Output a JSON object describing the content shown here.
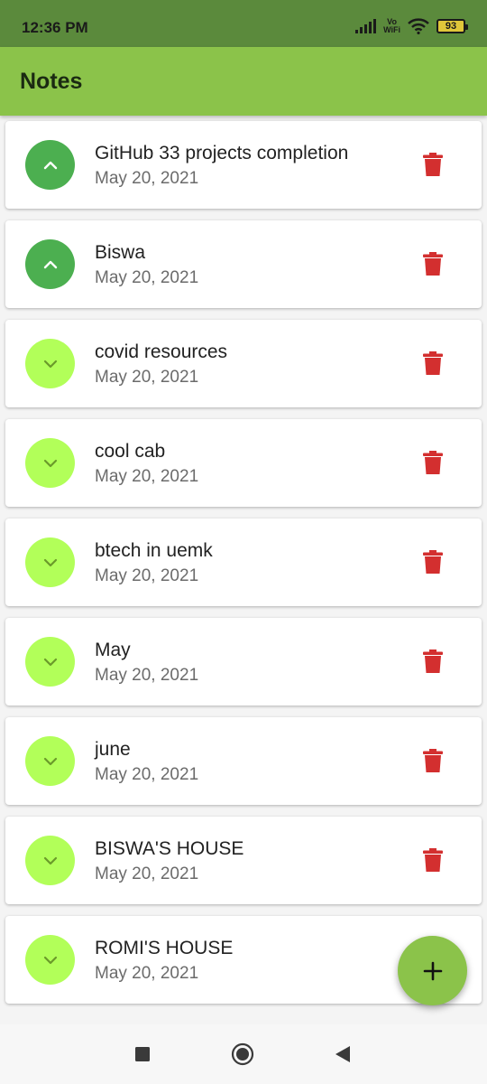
{
  "status_bar": {
    "time": "12:36 PM",
    "vowifi_top": "Vo",
    "vowifi_bottom": "WiFi",
    "battery": "93",
    "icons": [
      "signal-icon",
      "vowifi-icon",
      "wifi-icon",
      "battery-icon"
    ]
  },
  "app_bar": {
    "title": "Notes"
  },
  "notes": [
    {
      "title": "GitHub 33 projects completion",
      "date": "May 20, 2021",
      "expanded": true
    },
    {
      "title": "Biswa",
      "date": "May 20, 2021",
      "expanded": true
    },
    {
      "title": "covid resources",
      "date": "May 20, 2021",
      "expanded": false
    },
    {
      "title": "cool cab",
      "date": "May 20, 2021",
      "expanded": false
    },
    {
      "title": "btech in uemk",
      "date": "May 20, 2021",
      "expanded": false
    },
    {
      "title": "May",
      "date": "May 20, 2021",
      "expanded": false
    },
    {
      "title": "june",
      "date": "May 20, 2021",
      "expanded": false
    },
    {
      "title": "BISWA'S HOUSE",
      "date": "May 20, 2021",
      "expanded": false
    },
    {
      "title": "ROMI'S HOUSE",
      "date": "May 20, 2021",
      "expanded": false
    }
  ],
  "fab": {
    "icon": "plus-icon"
  },
  "nav_bar": {
    "icons": [
      "recents-square-icon",
      "home-circle-icon",
      "back-triangle-icon"
    ]
  },
  "colors": {
    "status_bar": "#5b8a3c",
    "app_bar": "#8bc34a",
    "toggle_expanded": "#4caf50",
    "toggle_collapsed": "#b2ff59",
    "delete": "#d32f2f",
    "fab": "#8bc34a"
  }
}
